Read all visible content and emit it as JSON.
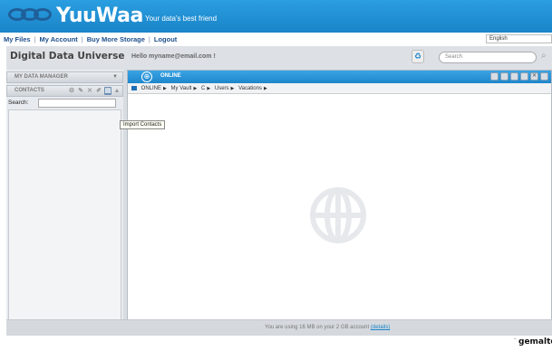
{
  "header": {
    "logo": "YuuWaa",
    "tagline": "Your data's best friend"
  },
  "topnav": {
    "links": [
      "My Files",
      "My Account",
      "Buy More Storage",
      "Logout"
    ],
    "language": "English"
  },
  "workspace": {
    "title": "Digital Data Universe",
    "greeting": "Hello myname@email.com !",
    "search_placeholder": "Search"
  },
  "sidebar": {
    "section1": "MY DATA MANAGER",
    "section2": "CONTACTS",
    "search_label": "Search:",
    "tooltip": "Import Contacts"
  },
  "main": {
    "title": "ONLINE",
    "breadcrumb": [
      "ONLINE",
      "My Vault",
      "C",
      "Users",
      "Vacations"
    ]
  },
  "status": {
    "text": "You are using 16 MB on your 2 GB account",
    "details_link": "(details)"
  },
  "footer": {
    "brand": "gemalto"
  },
  "colors": {
    "accent": "#1a84c9",
    "nav_link": "#1d4f8c"
  }
}
